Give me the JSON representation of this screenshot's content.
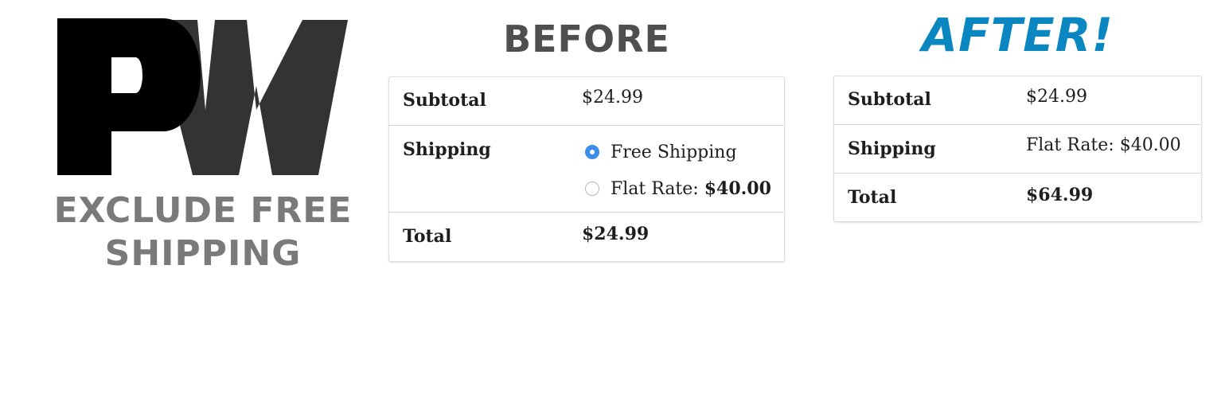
{
  "logo": {
    "letters": "PW",
    "tagline": [
      "EXCLUDE FREE",
      "SHIPPING"
    ]
  },
  "before": {
    "heading": "BEFORE",
    "rows": {
      "subtotal": {
        "label": "Subtotal",
        "value": "$24.99"
      },
      "shipping": {
        "label": "Shipping",
        "options": [
          {
            "label": "Free Shipping",
            "price": "",
            "selected": true
          },
          {
            "label": "Flat Rate: ",
            "price": "$40.00",
            "selected": false
          }
        ]
      },
      "total": {
        "label": "Total",
        "value": "$24.99"
      }
    }
  },
  "after": {
    "heading": "AFTER!",
    "rows": {
      "subtotal": {
        "label": "Subtotal",
        "value": "$24.99"
      },
      "shipping": {
        "label": "Shipping",
        "value": "Flat Rate: $40.00"
      },
      "total": {
        "label": "Total",
        "value": "$64.99"
      }
    }
  },
  "colors": {
    "accent": "#0a86c1",
    "radio_selected": "#3d8ee8",
    "heading_gray": "#4f4f4f",
    "tagline_gray": "#7a7a7a"
  }
}
